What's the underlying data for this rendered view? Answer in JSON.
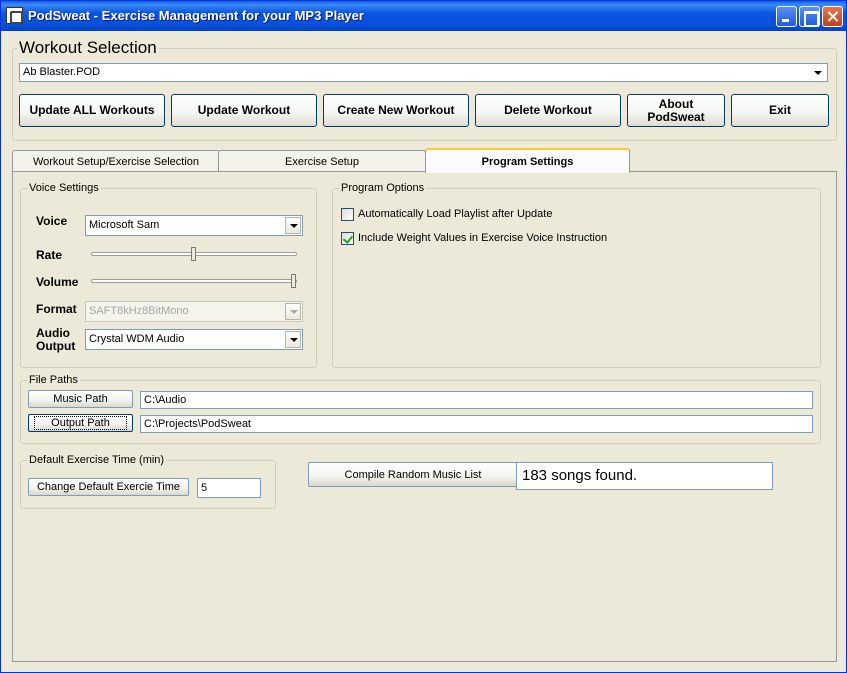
{
  "window": {
    "title": "PodSweat - Exercise Management for your MP3 Player"
  },
  "workout_selection": {
    "legend": "Workout Selection",
    "selected_workout": "Ab Blaster.POD",
    "buttons": {
      "update_all": "Update ALL Workouts",
      "update": "Update Workout",
      "create": "Create New Workout",
      "delete": "Delete Workout",
      "about_line1": "About",
      "about_line2": "PodSweat",
      "exit": "Exit"
    }
  },
  "tabs": [
    {
      "label": "Workout Setup/Exercise Selection",
      "active": false
    },
    {
      "label": "Exercise Setup",
      "active": false
    },
    {
      "label": "Program Settings",
      "active": true
    }
  ],
  "voice_settings": {
    "legend": "Voice Settings",
    "voice_label": "Voice",
    "voice_value": "Microsoft Sam",
    "rate_label": "Rate",
    "rate_level": 0.5,
    "volume_label": "Volume",
    "volume_level": 1.0,
    "format_label": "Format",
    "format_value": "SAFT8kHz8BitMono",
    "audio_output_label_1": "Audio",
    "audio_output_label_2": "Output",
    "audio_output_value": "Crystal WDM Audio"
  },
  "program_options": {
    "legend": "Program Options",
    "auto_load_label": "Automatically Load Playlist after Update",
    "auto_load_checked": false,
    "include_weight_label": "Include Weight Values in Exercise Voice Instruction",
    "include_weight_checked": true
  },
  "file_paths": {
    "legend": "File Paths",
    "music_path_button": "Music Path",
    "music_path_value": "C:\\Audio",
    "output_path_button": "Output Path",
    "output_path_value": "C:\\Projects\\PodSweat"
  },
  "default_time": {
    "legend": "Default Exercise Time (min)",
    "change_button": "Change Default Exercie Time",
    "value": "5"
  },
  "compile": {
    "button": "Compile Random Music List",
    "status": "183 songs found."
  }
}
